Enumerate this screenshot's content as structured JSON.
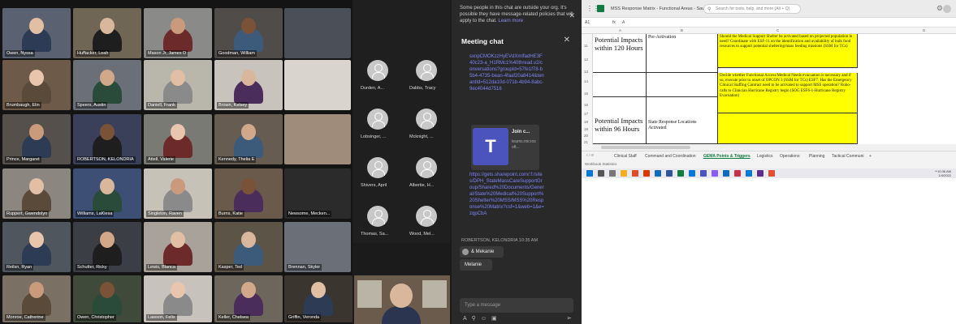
{
  "gallery": {
    "tiles": [
      {
        "name": "Owen, Nyssa"
      },
      {
        "name": "Huffacker, Leah"
      },
      {
        "name": "Mason Jr, James D"
      },
      {
        "name": "Goodman, William"
      },
      {
        "name": "Brumbaugh, Elin"
      },
      {
        "name": "Speers, Austin"
      },
      {
        "name": "Daniell, Frank"
      },
      {
        "name": "Brown, Kelsey"
      },
      {
        "name": "Prince, Margaret"
      },
      {
        "name": "ROBERTSON, KELONDRIA"
      },
      {
        "name": "Attell, Valerie"
      },
      {
        "name": "Kennedy, Thelia E"
      },
      {
        "name": "Ruppert, Gwendolyn"
      },
      {
        "name": "Williams, LaKiesa"
      },
      {
        "name": "Singleton, Raven"
      },
      {
        "name": "Burns, Katie"
      },
      {
        "name": "Reilsn, Ryan"
      },
      {
        "name": "Schutter, Ricky"
      },
      {
        "name": "Lewis, Blanca"
      },
      {
        "name": "Kasper, Ted"
      },
      {
        "name": "Monroe, Catherine"
      },
      {
        "name": "Owen, Christopher"
      },
      {
        "name": "Lawson, Felix"
      },
      {
        "name": "Keller, Chelsea"
      },
      {
        "name": "Griffin, Veronda"
      }
    ],
    "name_only_tile": "Newsome, Mecken...",
    "extra_name": "Brennan, Skyler"
  },
  "avatars": [
    {
      "name": "Durden, A..."
    },
    {
      "name": "Dabbs, Tracy"
    },
    {
      "name": "Lobsinger, ..."
    },
    {
      "name": "Mcknight, ..."
    },
    {
      "name": "Shivers, April"
    },
    {
      "name": "Albertie, H..."
    },
    {
      "name": "Thomas, Sa..."
    },
    {
      "name": "Wood, Mel..."
    }
  ],
  "chat": {
    "notice": "Some people in this chat are outside your org. It's possible they have message-related policies that will apply to the chat.",
    "learn_more": "Learn more",
    "title": "Meeting chat",
    "link1": "sxnpCMOKzzHyEVdXmIfadHE3F40c23-a_H1RMc1%40thread.v2/conversations?groupId=57fe1f78-b5b4-4735-bean-4faaf20a8414&tenantId=512da10d-071b-4b94-8abc-9ec4044d7516",
    "card_title": "Join c...",
    "card_sub": "teams.microsoft...",
    "card_logo": "T",
    "link2": "https://gets.sharepoint.com/:f:/sites/DPH_StateMassCareSupportGroup/Shared%20Documents/General/State%20Medical%20Support%20Shelter%20MSS/MSS%20Response%20Matrix?csf=1&web=1&e=zqpCbA",
    "meta": "ROBERTSON, KELONDRIA  10:35 AM",
    "reaction": "& Mekanie",
    "bubble": "Melanie",
    "compose_placeholder": "Type a message"
  },
  "excel": {
    "doc_title": "MSS Response Matrix - Functional Areas - Saved",
    "search_placeholder": "Search for tools, help, and more (Alt + Q)",
    "cell_ref": "A1",
    "formula_value": "A",
    "col_headers": [
      "A",
      "B",
      "C",
      "D"
    ],
    "row_numbers": [
      "11",
      "12",
      "13",
      "14",
      "15",
      "16",
      "17",
      "18",
      "19",
      "20",
      "21"
    ],
    "rows": [
      {
        "a": "Potential Impacts within 120 Hours",
        "b": "Pre-Activation",
        "c": "Should the Medical Support Shelter be activated based on projected population in need? Coordinate with ESF-11 on the identification and availability of bulk food resources to support potential sheltering/mass feeding missions (SSM for TCs)"
      },
      {
        "a": "",
        "b": "",
        "c": "Decide whether Functional Access/Medical Needs evacuation is necessary and if so, execute prior to onset of OPCON 3 (SSM for TCs) ESF7. Has the Emergency Clinical Staffing Contract need to be activated to support MSS operation? Robo-calls to Clinician Hurricane Registry begin (SOG ESF6-1-Hurricane Registry Evacuation)"
      },
      {
        "a": "Potential Impacts within 96 Hours",
        "b": "State Response Locations Activated",
        "c": ""
      }
    ],
    "sheet_tabs": [
      "Clinical Staff",
      "Command and Coordination",
      "GEMA Points & Triggers",
      "Logistics",
      "Operations",
      "Planning",
      "Tactical Communi"
    ],
    "active_tab": "GEMA Points & Triggers",
    "status": "Workbook Statistics"
  },
  "taskbar": {
    "time": "10:36 AM",
    "date": "1/4/2022"
  },
  "colors": {
    "excel_green": "#107c41",
    "teams_purple": "#4b53bc",
    "highlight_yellow": "#ffff00",
    "link_color": "#7f85f5"
  }
}
